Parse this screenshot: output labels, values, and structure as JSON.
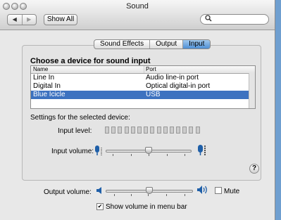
{
  "window": {
    "title": "Sound"
  },
  "toolbar": {
    "back_glyph": "◀",
    "forward_glyph": "▶",
    "show_all_label": "Show All",
    "search_placeholder": ""
  },
  "tabs": [
    {
      "label": "Sound Effects",
      "selected": false
    },
    {
      "label": "Output",
      "selected": false
    },
    {
      "label": "Input",
      "selected": true
    }
  ],
  "input": {
    "heading": "Choose a device for sound input",
    "columns": [
      "Name",
      "Port"
    ],
    "rows": [
      {
        "name": "Line In",
        "port": "Audio line-in port",
        "selected": false
      },
      {
        "name": "Digital In",
        "port": "Optical digital-in port",
        "selected": false
      },
      {
        "name": "Blue Icicle",
        "port": "USB",
        "selected": true
      }
    ],
    "settings_label": "Settings for the selected device:",
    "input_level_label": "Input level:",
    "input_level_segments": 15,
    "input_volume_label": "Input volume:",
    "input_volume_value": 0.5
  },
  "output": {
    "output_volume_label": "Output volume:",
    "output_volume_value": 0.5,
    "mute_label": "Mute",
    "mute_checked": false,
    "show_in_menu_bar_label": "Show volume in menu bar",
    "show_in_menu_bar_checked": true
  },
  "icons": {
    "close": "window-close-icon",
    "minimize": "window-minimize-icon",
    "zoom": "window-zoom-icon",
    "search": "search-icon",
    "mic_low": "microphone-low-icon",
    "mic_high": "microphone-high-icon",
    "speaker_low": "speaker-low-icon",
    "speaker_high": "speaker-high-icon",
    "help": "help-icon",
    "check": "checkmark-icon"
  },
  "colors": {
    "selection": "#3d72c0",
    "tab_selected": "#4f8fd4",
    "desktop": "#6f9fd0"
  }
}
